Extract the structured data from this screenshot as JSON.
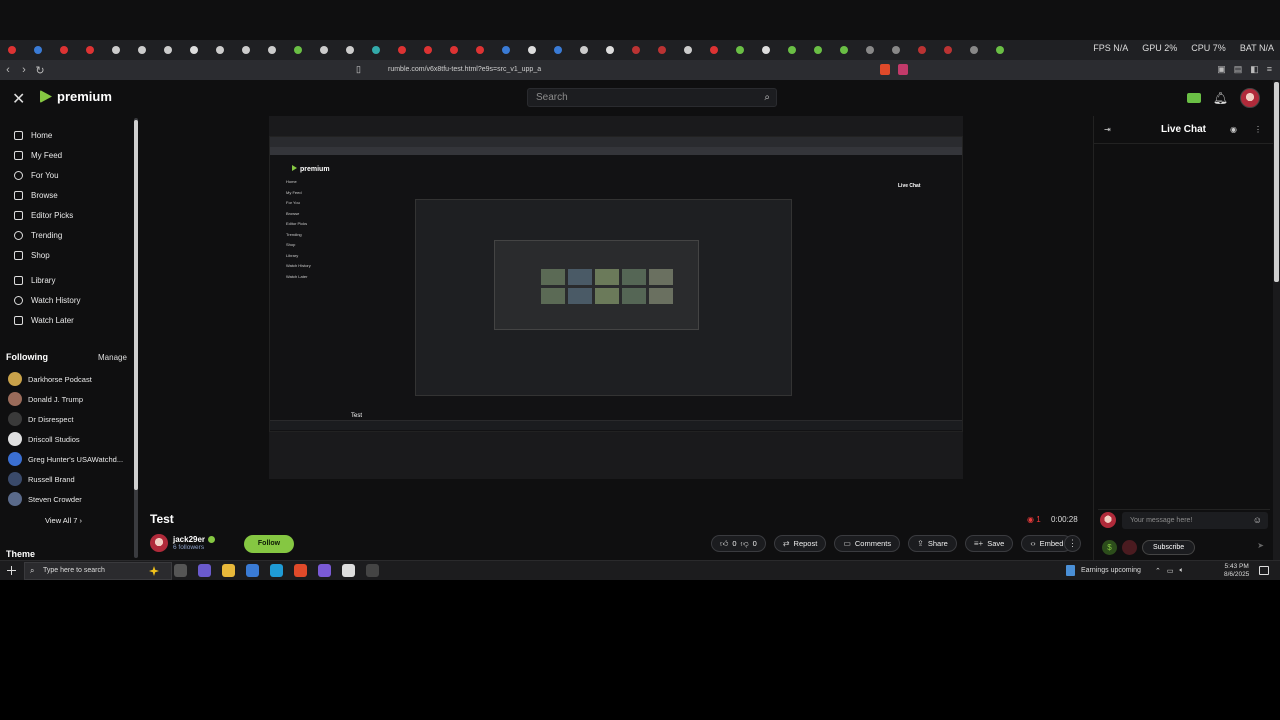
{
  "browser": {
    "url": "rumble.com/v6x8tfu-test.html?e9s=src_v1_upp_a",
    "tab_stats": {
      "fps": "FPS N/A",
      "gpu": "GPU 2%",
      "cpu": "CPU 7%",
      "bat": "BAT N/A"
    }
  },
  "header": {
    "brand": "premium",
    "search_placeholder": "Search"
  },
  "sidebar": {
    "nav": [
      {
        "label": "Home",
        "icon": "home-icon"
      },
      {
        "label": "My Feed",
        "icon": "feed-icon"
      },
      {
        "label": "For You",
        "icon": "for-you-icon"
      },
      {
        "label": "Browse",
        "icon": "browse-icon"
      },
      {
        "label": "Editor Picks",
        "icon": "editor-picks-icon"
      },
      {
        "label": "Trending",
        "icon": "trending-icon"
      },
      {
        "label": "Shop",
        "icon": "shop-icon"
      },
      {
        "label": "Library",
        "icon": "library-icon"
      },
      {
        "label": "Watch History",
        "icon": "history-icon"
      },
      {
        "label": "Watch Later",
        "icon": "watch-later-icon"
      }
    ],
    "following_title": "Following",
    "manage_label": "Manage",
    "following": [
      {
        "name": "Darkhorse Podcast",
        "color": "#c9a24a"
      },
      {
        "name": "Donald J. Trump",
        "color": "#9a6b5a"
      },
      {
        "name": "Dr Disrespect",
        "color": "#3a3a3a"
      },
      {
        "name": "Driscoll Studios",
        "color": "#e0e0e0"
      },
      {
        "name": "Greg Hunter's USAWatchd...",
        "color": "#3b6fd1"
      },
      {
        "name": "Russell Brand",
        "color": "#3a4a6a"
      },
      {
        "name": "Steven Crowder",
        "color": "#5a6a8a"
      }
    ],
    "view_all": "View All 7 ›",
    "theme_title": "Theme"
  },
  "video": {
    "title": "Test",
    "channel": "jack29er",
    "followers": "6 followers",
    "follow_label": "Follow",
    "live_count": "1",
    "duration": "0:00:28",
    "likes": "0",
    "dislikes": "0",
    "actions": [
      {
        "label": "Repost",
        "icon": "repost-icon"
      },
      {
        "label": "Comments",
        "icon": "comments-icon"
      },
      {
        "label": "Share",
        "icon": "share-icon"
      },
      {
        "label": "Save",
        "icon": "save-icon"
      },
      {
        "label": "Embed",
        "icon": "embed-icon"
      }
    ]
  },
  "chat": {
    "title": "Live Chat",
    "placeholder": "Your message here!",
    "subscribe_label": "Subscribe"
  },
  "taskbar": {
    "search_placeholder": "Type here to search",
    "weather": "Earnings upcoming",
    "time": "5:43 PM",
    "date": "8/6/2025"
  },
  "colors": {
    "accent": "#85c742",
    "live": "#ea3b3b"
  }
}
